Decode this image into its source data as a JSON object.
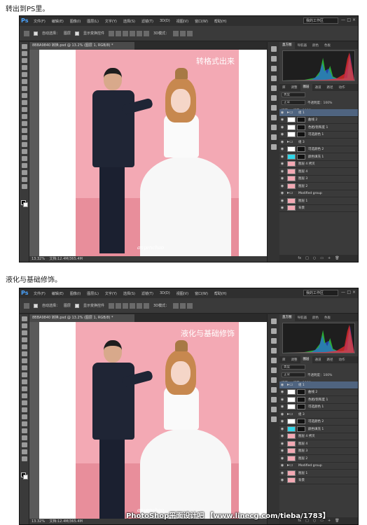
{
  "captions": [
    "转出到PS里。",
    "液化与基础修饰。"
  ],
  "app": {
    "logo": "Ps",
    "menus": [
      "文件(F)",
      "编辑(E)",
      "图像(I)",
      "图层(L)",
      "文字(Y)",
      "选择(S)",
      "滤镜(T)",
      "3D(D)",
      "视图(V)",
      "窗口(W)",
      "帮助(H)"
    ],
    "workspace": "我的工作区",
    "window_controls": [
      "—",
      "□",
      "×"
    ]
  },
  "options": {
    "auto_select_label": "自动选择：",
    "auto_select_value": "图层",
    "show_transform": "显示变换控件",
    "mode_3d": "3D模式："
  },
  "document": {
    "tab_label": "8BBA9840 转换.psd @ 13.2% (图层 1, RGB/8) *",
    "zoom": "13.32%",
    "doc_info": "文档:12.4M/365.4M"
  },
  "photo_titles": [
    "转格式出来",
    "液化与基础修饰"
  ],
  "signature": "anyenchao",
  "right_panel": {
    "top_tabs": [
      "直方图",
      "导航器",
      "颜色",
      "色板"
    ],
    "mid_tabs": [
      "库",
      "调整",
      "图层",
      "通道",
      "路径",
      "动作"
    ],
    "kind_label": "类型",
    "blend_mode": "正常",
    "opacity_label": "不透明度：100%",
    "lock_label": "锁定：",
    "fill_label": "填充：100%",
    "footer_icons": [
      "fx",
      "□",
      "○",
      "▭",
      "+",
      "🗑"
    ]
  },
  "layers": [
    {
      "name": "组 1",
      "kind": "folder",
      "selected": true
    },
    {
      "name": "曲线 2",
      "kind": "adjust"
    },
    {
      "name": "色相/饱和度 1",
      "kind": "adjust"
    },
    {
      "name": "可选颜色 1",
      "kind": "adjust"
    },
    {
      "name": "组 3",
      "kind": "folder"
    },
    {
      "name": "可选颜色 2",
      "kind": "adjust"
    },
    {
      "name": "颜色填充 1",
      "kind": "cyan"
    },
    {
      "name": "图层 4 拷贝",
      "kind": "pink"
    },
    {
      "name": "图层 4",
      "kind": "pink"
    },
    {
      "name": "图层 3",
      "kind": "pink"
    },
    {
      "name": "图层 2",
      "kind": "pink"
    },
    {
      "name": "Modified group",
      "kind": "folder"
    },
    {
      "name": "图层 1",
      "kind": "pink"
    },
    {
      "name": "背景",
      "kind": "pink"
    }
  ],
  "footer_watermark": "PhotoShop平面设计吧 【www.linecg.com/tieba/1783】"
}
